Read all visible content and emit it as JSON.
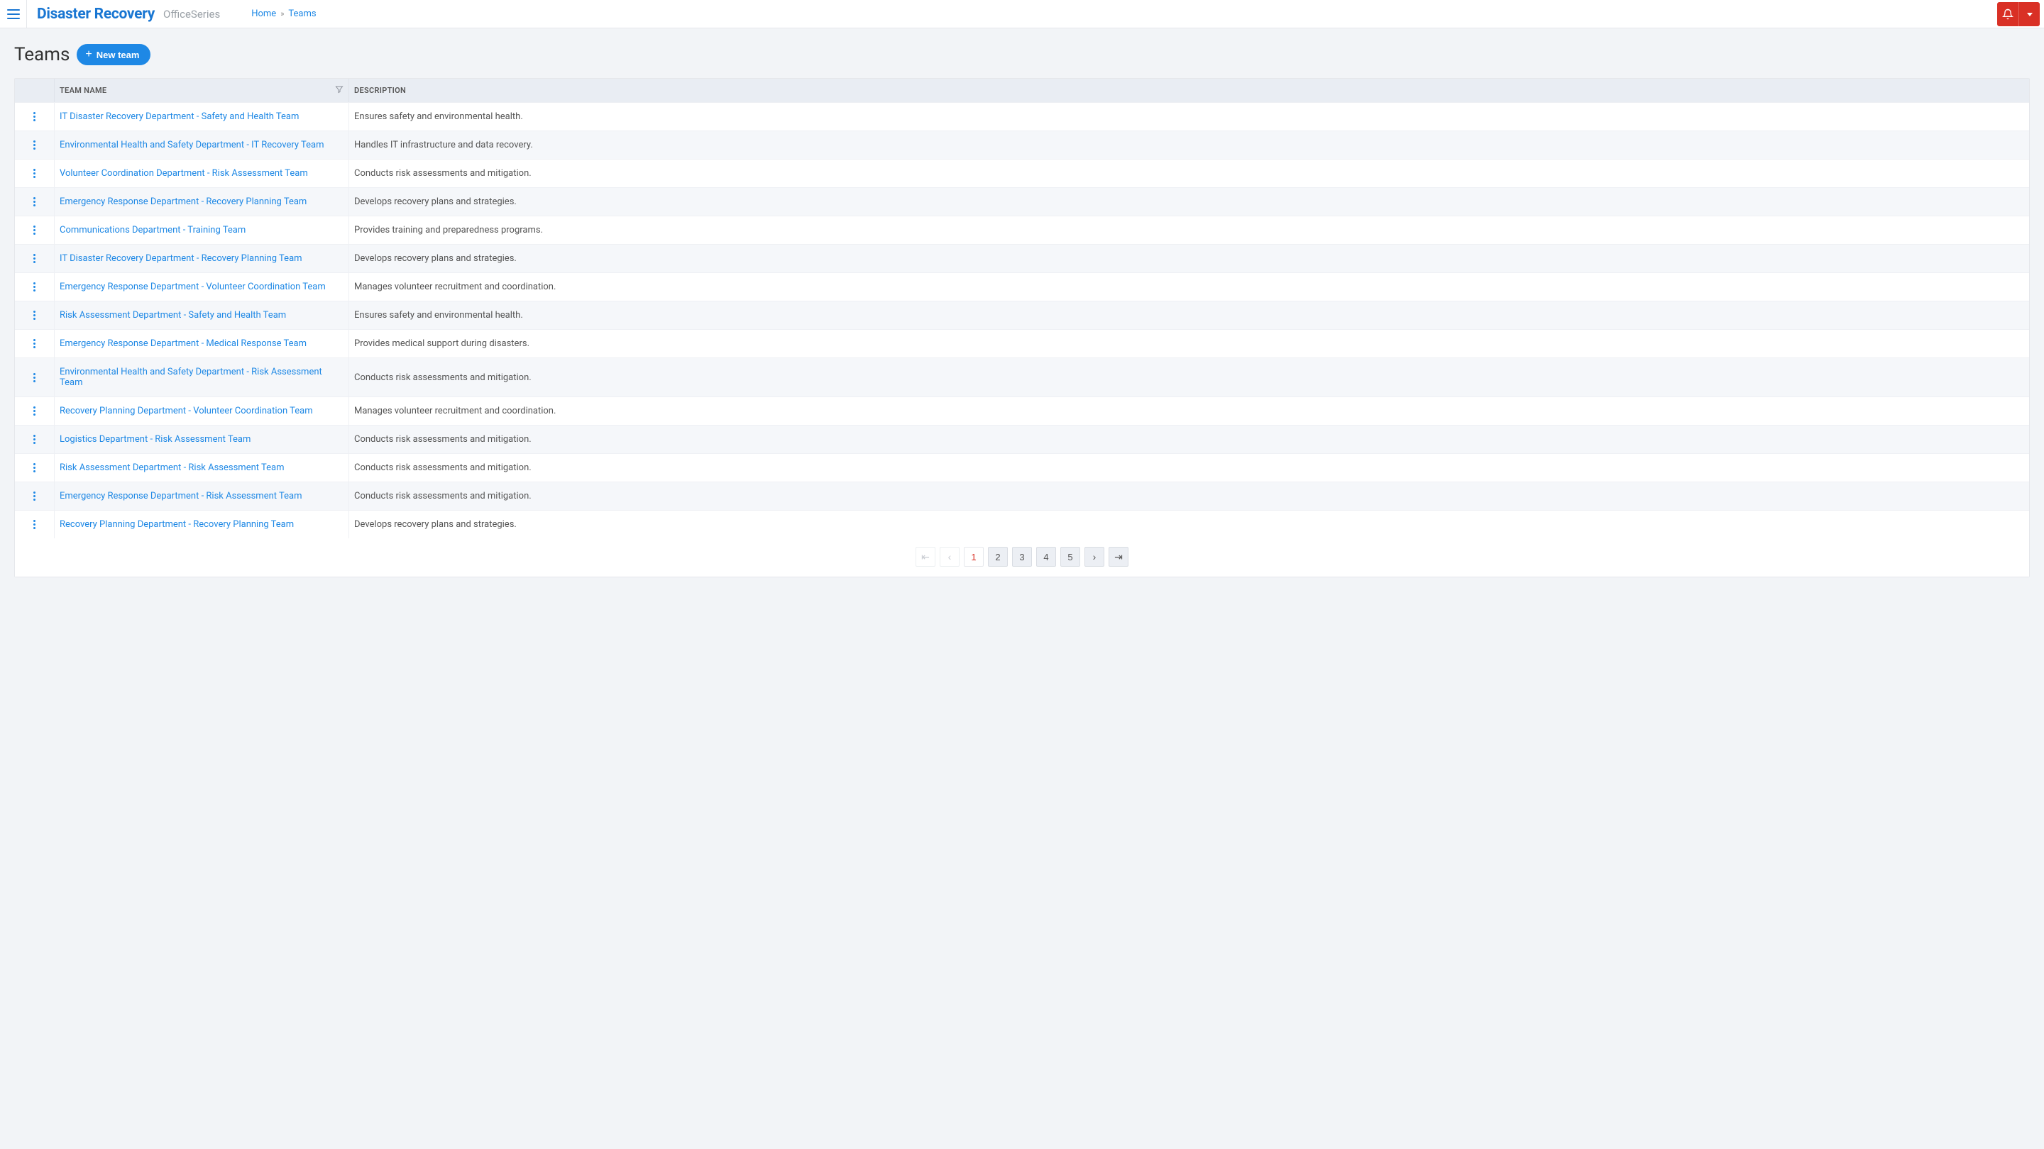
{
  "header": {
    "app_title": "Disaster Recovery",
    "app_subtitle": "OfficeSeries",
    "breadcrumbs": {
      "home": "Home",
      "current": "Teams"
    }
  },
  "page": {
    "title": "Teams",
    "new_button": "New team"
  },
  "table": {
    "columns": {
      "name": "Team Name",
      "description": "Description"
    }
  },
  "rows": [
    {
      "name": "IT Disaster Recovery Department - Safety and Health Team",
      "description": "Ensures safety and environmental health."
    },
    {
      "name": "Environmental Health and Safety Department - IT Recovery Team",
      "description": "Handles IT infrastructure and data recovery."
    },
    {
      "name": "Volunteer Coordination Department - Risk Assessment Team",
      "description": "Conducts risk assessments and mitigation."
    },
    {
      "name": "Emergency Response Department - Recovery Planning Team",
      "description": "Develops recovery plans and strategies."
    },
    {
      "name": "Communications Department - Training Team",
      "description": "Provides training and preparedness programs."
    },
    {
      "name": "IT Disaster Recovery Department - Recovery Planning Team",
      "description": "Develops recovery plans and strategies."
    },
    {
      "name": "Emergency Response Department - Volunteer Coordination Team",
      "description": "Manages volunteer recruitment and coordination."
    },
    {
      "name": "Risk Assessment Department - Safety and Health Team",
      "description": "Ensures safety and environmental health."
    },
    {
      "name": "Emergency Response Department - Medical Response Team",
      "description": "Provides medical support during disasters."
    },
    {
      "name": "Environmental Health and Safety Department - Risk Assessment Team",
      "description": "Conducts risk assessments and mitigation."
    },
    {
      "name": "Recovery Planning Department - Volunteer Coordination Team",
      "description": "Manages volunteer recruitment and coordination."
    },
    {
      "name": "Logistics Department - Risk Assessment Team",
      "description": "Conducts risk assessments and mitigation."
    },
    {
      "name": "Risk Assessment Department - Risk Assessment Team",
      "description": "Conducts risk assessments and mitigation."
    },
    {
      "name": "Emergency Response Department - Risk Assessment Team",
      "description": "Conducts risk assessments and mitigation."
    },
    {
      "name": "Recovery Planning Department - Recovery Planning Team",
      "description": "Develops recovery plans and strategies."
    }
  ],
  "pagination": {
    "pages": [
      "1",
      "2",
      "3",
      "4",
      "5"
    ],
    "current": "1"
  }
}
